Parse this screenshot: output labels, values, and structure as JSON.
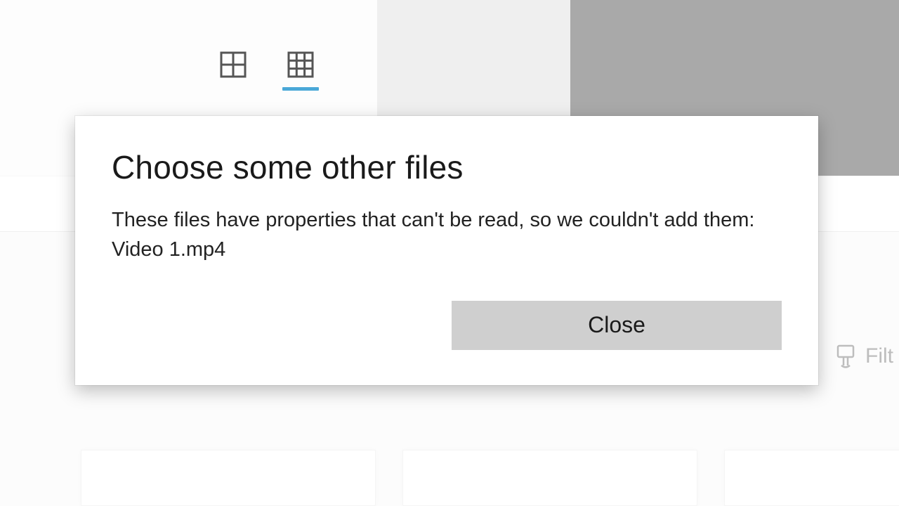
{
  "toolbar": {
    "view_large_grid": "grid-2x2",
    "view_small_grid": "grid-3x3"
  },
  "filter": {
    "label": "Filt"
  },
  "dialog": {
    "title": "Choose some other files",
    "message_line1": "These files have properties that can't be read, so we couldn't add them:",
    "message_line2": "Video 1.mp4",
    "close_label": "Close"
  }
}
